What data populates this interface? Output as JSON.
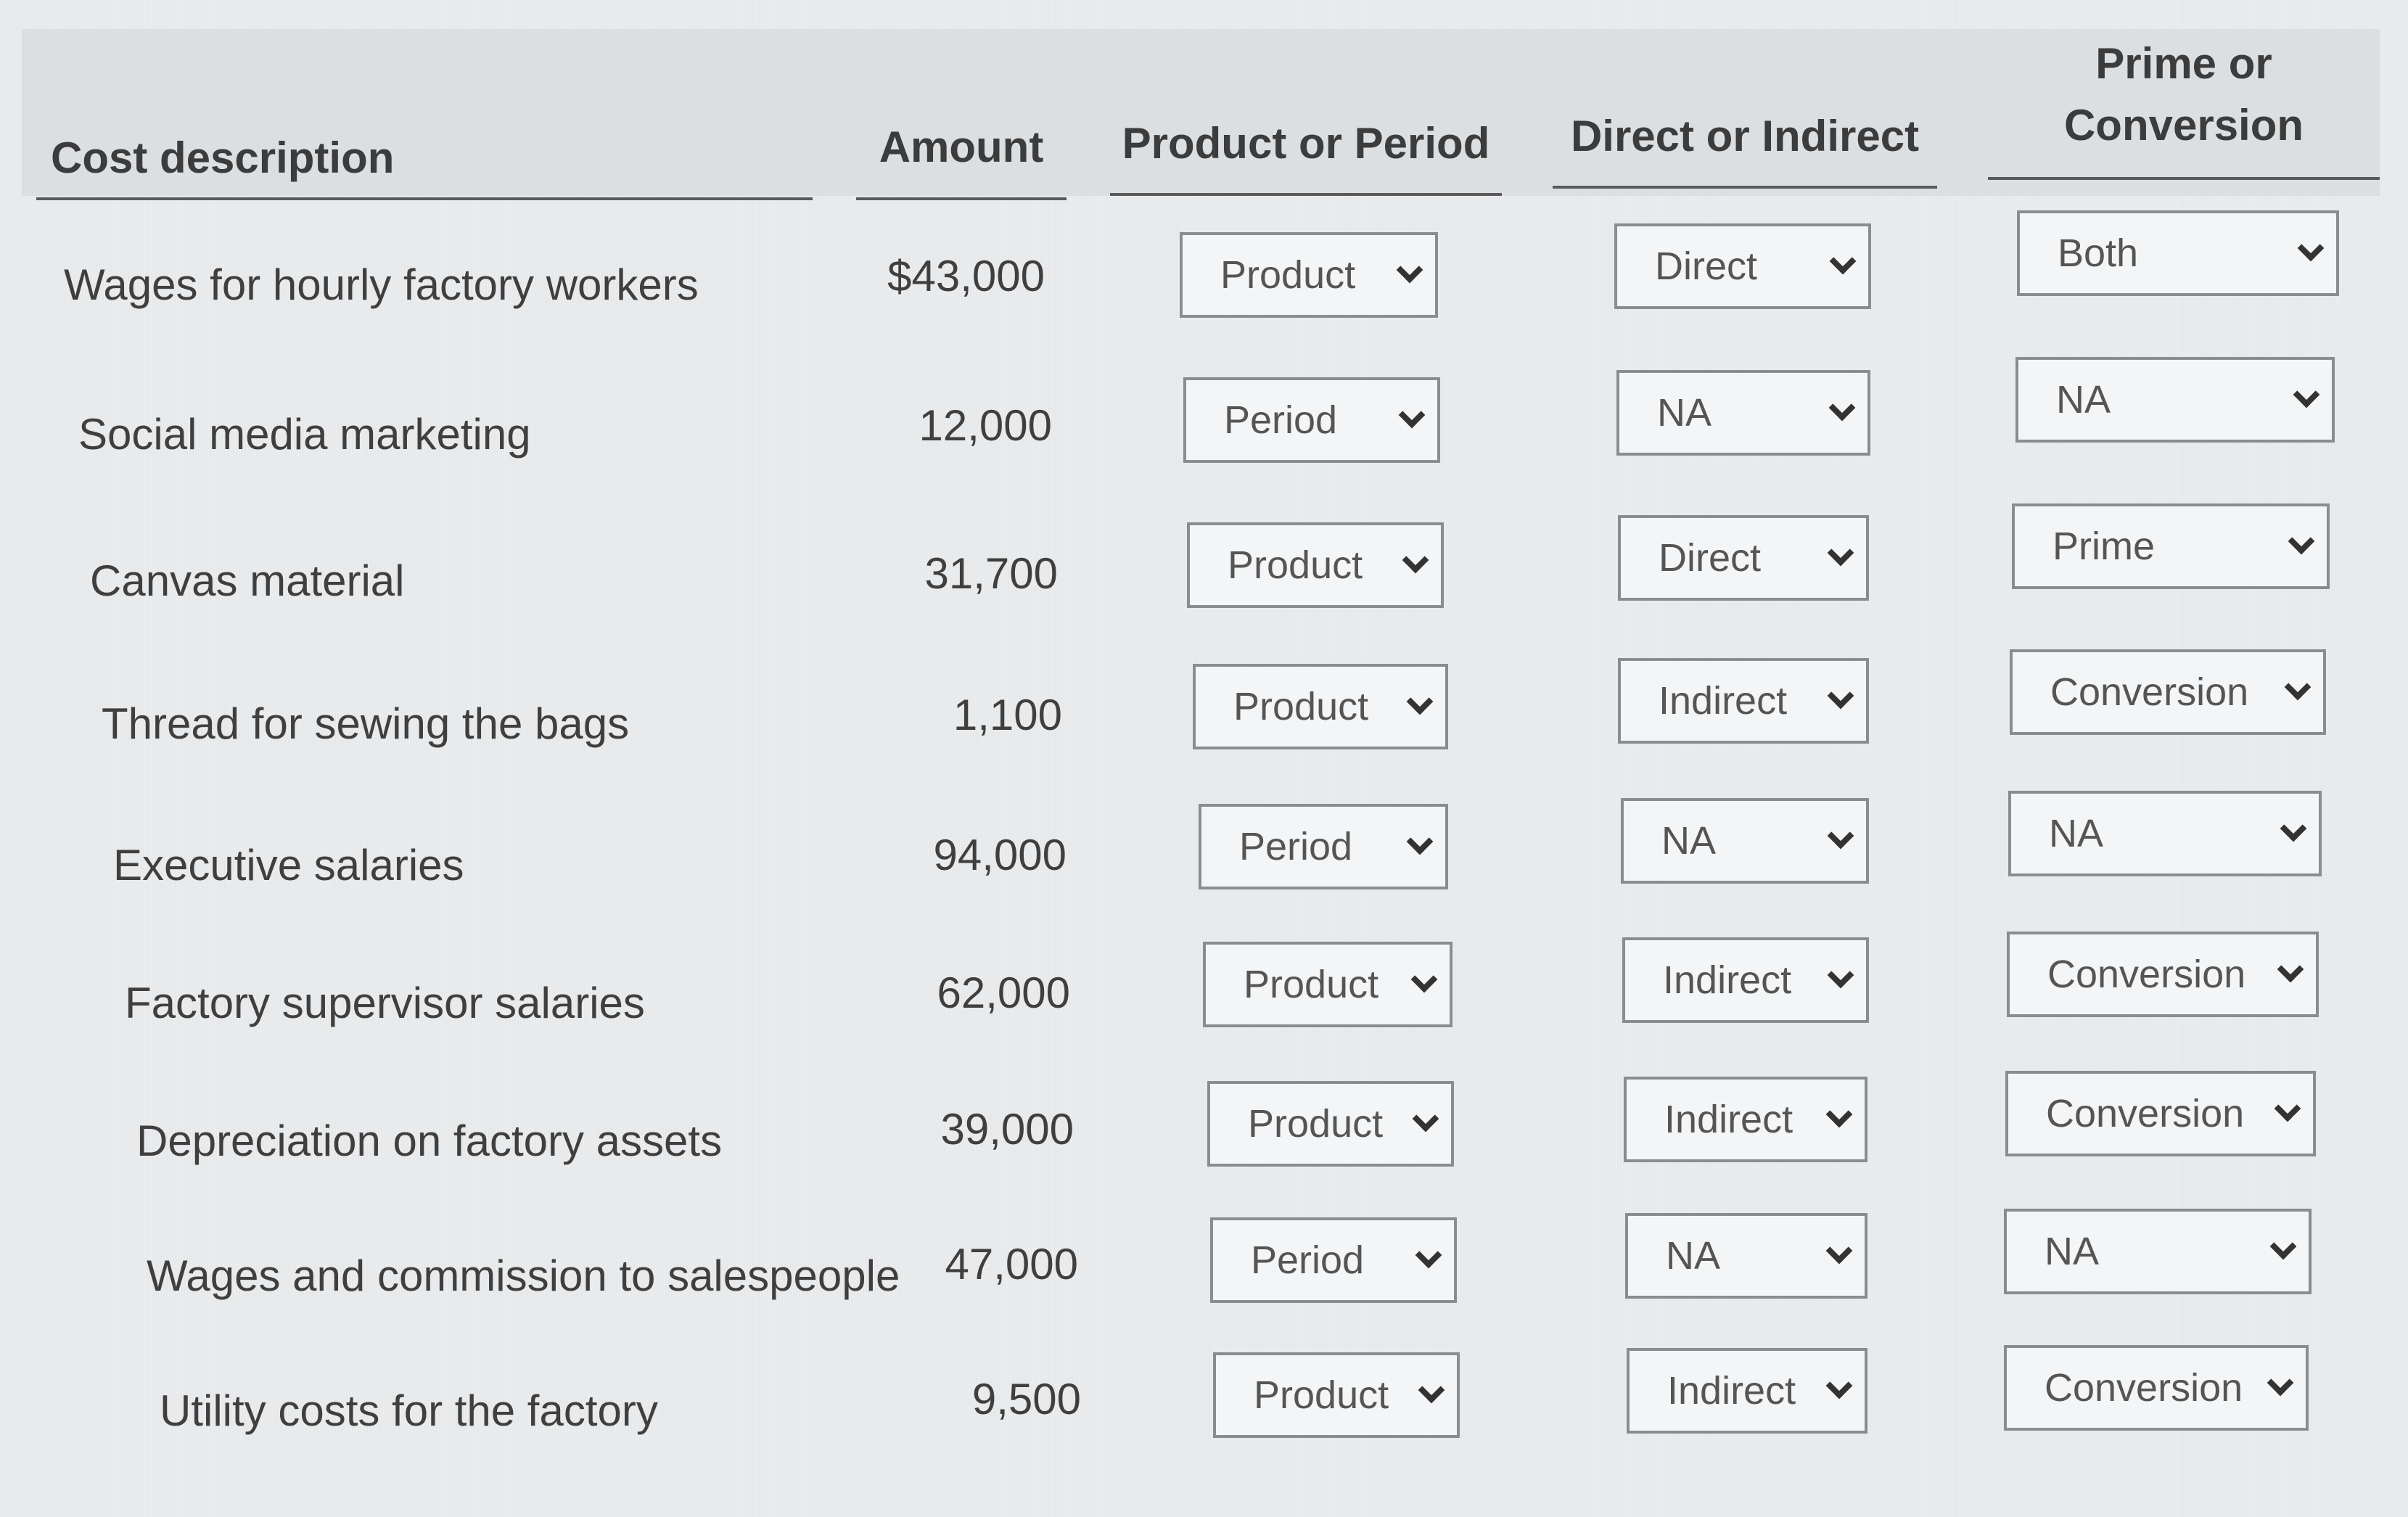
{
  "headers": {
    "cost_description": "Cost description",
    "amount": "Amount",
    "product_or_period": "Product or Period",
    "direct_or_indirect": "Direct or Indirect",
    "prime_or_conversion_line1": "Prime or",
    "prime_or_conversion_line2": "Conversion"
  },
  "rows": [
    {
      "description": "Wages for hourly factory workers",
      "amount": "$43,000",
      "product_period": "Product",
      "direct_indirect": "Direct",
      "prime_conversion": "Both"
    },
    {
      "description": "Social media marketing",
      "amount": "12,000",
      "product_period": "Period",
      "direct_indirect": "NA",
      "prime_conversion": "NA"
    },
    {
      "description": "Canvas material",
      "amount": "31,700",
      "product_period": "Product",
      "direct_indirect": "Direct",
      "prime_conversion": "Prime"
    },
    {
      "description": "Thread for sewing the bags",
      "amount": "1,100",
      "product_period": "Product",
      "direct_indirect": "Indirect",
      "prime_conversion": "Conversion"
    },
    {
      "description": "Executive salaries",
      "amount": "94,000",
      "product_period": "Period",
      "direct_indirect": "NA",
      "prime_conversion": "NA"
    },
    {
      "description": "Factory supervisor salaries",
      "amount": "62,000",
      "product_period": "Product",
      "direct_indirect": "Indirect",
      "prime_conversion": "Conversion"
    },
    {
      "description": "Depreciation on factory assets",
      "amount": "39,000",
      "product_period": "Product",
      "direct_indirect": "Indirect",
      "prime_conversion": "Conversion"
    },
    {
      "description": "Wages and commission to salespeople",
      "amount": "47,000",
      "product_period": "Period",
      "direct_indirect": "NA",
      "prime_conversion": "NA"
    },
    {
      "description": "Utility costs for the factory",
      "amount": "9,500",
      "product_period": "Product",
      "direct_indirect": "Indirect",
      "prime_conversion": "Conversion"
    }
  ]
}
